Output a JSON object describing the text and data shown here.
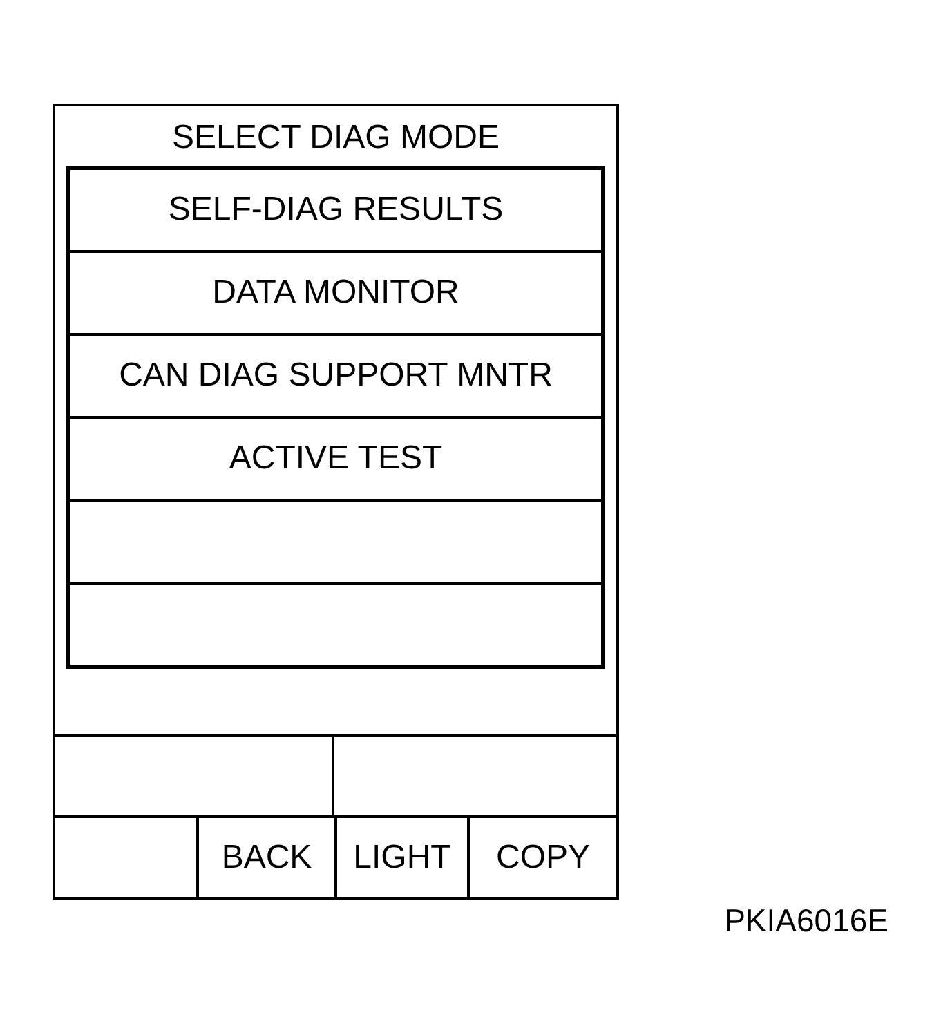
{
  "screen": {
    "title": "SELECT DIAG MODE"
  },
  "menu_items": [
    {
      "label": "SELF-DIAG RESULTS"
    },
    {
      "label": "DATA MONITOR"
    },
    {
      "label": "CAN DIAG SUPPORT MNTR"
    },
    {
      "label": "ACTIVE TEST"
    }
  ],
  "buttons": [
    {
      "label": "BACK"
    },
    {
      "label": "LIGHT"
    },
    {
      "label": "COPY"
    }
  ],
  "figure_code": "PKIA6016E"
}
